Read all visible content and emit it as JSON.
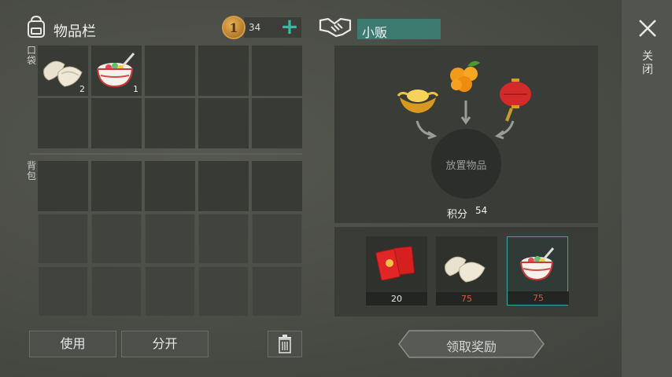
{
  "inventory": {
    "title": "物品栏",
    "coins": "34",
    "coin_symbol": "1",
    "pocket_label": "口袋",
    "bag_label": "背包",
    "pocket_slots": [
      {
        "icon": "dumplings-icon",
        "count": "2"
      },
      {
        "icon": "tangyuan-bowl-icon",
        "count": "1"
      },
      {},
      {},
      {},
      {},
      {},
      {},
      {},
      {}
    ],
    "use_label": "使用",
    "split_label": "分开"
  },
  "vendor": {
    "name": "小贩",
    "place_item": "放置物品",
    "score_label": "积分",
    "score_value": "54",
    "accepted_items": [
      "gold-ingot-icon",
      "kumquat-icon",
      "red-lantern-icon"
    ],
    "rewards": [
      {
        "icon": "red-envelope-icon",
        "cost": "20",
        "cost_color": "#e8e8e8"
      },
      {
        "icon": "dumplings-icon",
        "cost": "75",
        "cost_color": "#e0583e"
      },
      {
        "icon": "tangyuan-bowl-icon",
        "cost": "75",
        "cost_color": "#e0583e"
      }
    ],
    "claim_label": "领取奖励"
  },
  "close_label": "关闭",
  "colors": {
    "accent": "#2fbfa0",
    "vendor_tag": "#3d7a6f",
    "price_unaffordable": "#e0583e"
  }
}
